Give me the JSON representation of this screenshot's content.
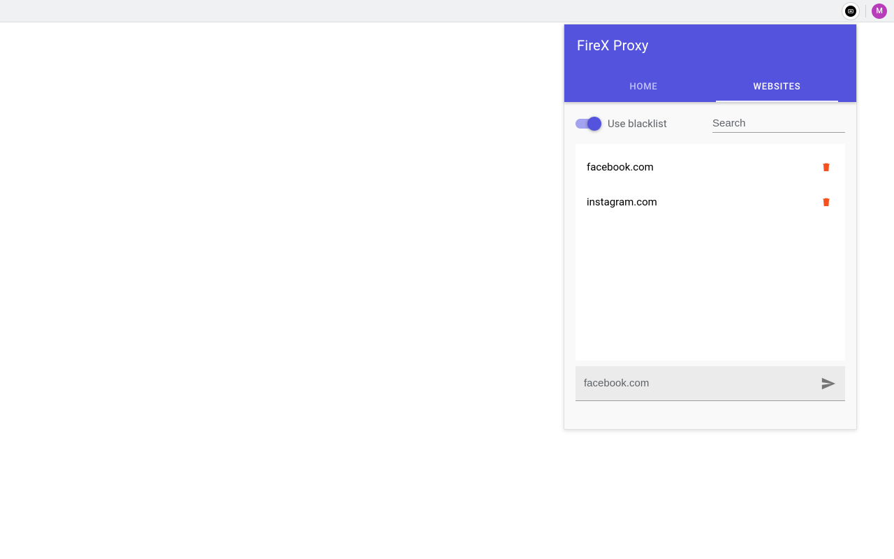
{
  "browser": {
    "profile_initial": "M"
  },
  "popup": {
    "title": "FireX Proxy",
    "tabs": {
      "home": "HOME",
      "websites": "WEBSITES"
    },
    "toggle_label": "Use blacklist",
    "search_placeholder": "Search",
    "list": [
      {
        "domain": "facebook.com"
      },
      {
        "domain": "instagram.com"
      }
    ],
    "add_placeholder": "facebook.com"
  }
}
